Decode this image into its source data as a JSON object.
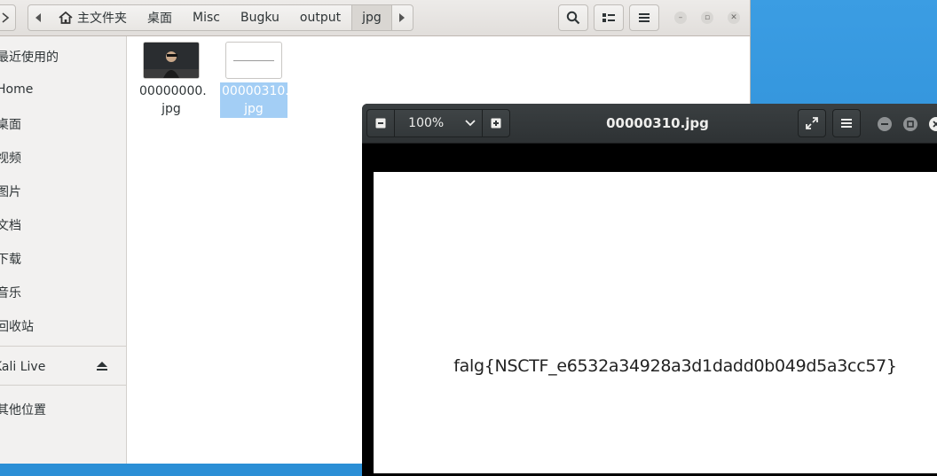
{
  "file_manager": {
    "path": [
      "主文件夹",
      "桌面",
      "Misc",
      "Bugku",
      "output",
      "jpg"
    ],
    "sidebar": [
      {
        "label": "最近使用的"
      },
      {
        "label": "Home"
      },
      {
        "label": "桌面"
      },
      {
        "label": "视频"
      },
      {
        "label": "图片"
      },
      {
        "label": "文档"
      },
      {
        "label": "下载"
      },
      {
        "label": "音乐"
      },
      {
        "label": "回收站"
      },
      {
        "label": "Kali Live"
      },
      {
        "label": "其他位置"
      }
    ],
    "files": [
      {
        "name_line1": "00000000.",
        "name_line2": "jpg",
        "selected": false
      },
      {
        "name_line1": "00000310.",
        "name_line2": "jpg",
        "selected": true
      }
    ]
  },
  "viewer": {
    "zoom": "100%",
    "title": "00000310.jpg",
    "image_text": "falg{NSCTF_e6532a34928a3d1dadd0b049d5a3cc57}"
  },
  "colors": {
    "selection": "#a3cef5",
    "desktop": "#2b8fd6",
    "viewer_header": "#2e3234"
  }
}
